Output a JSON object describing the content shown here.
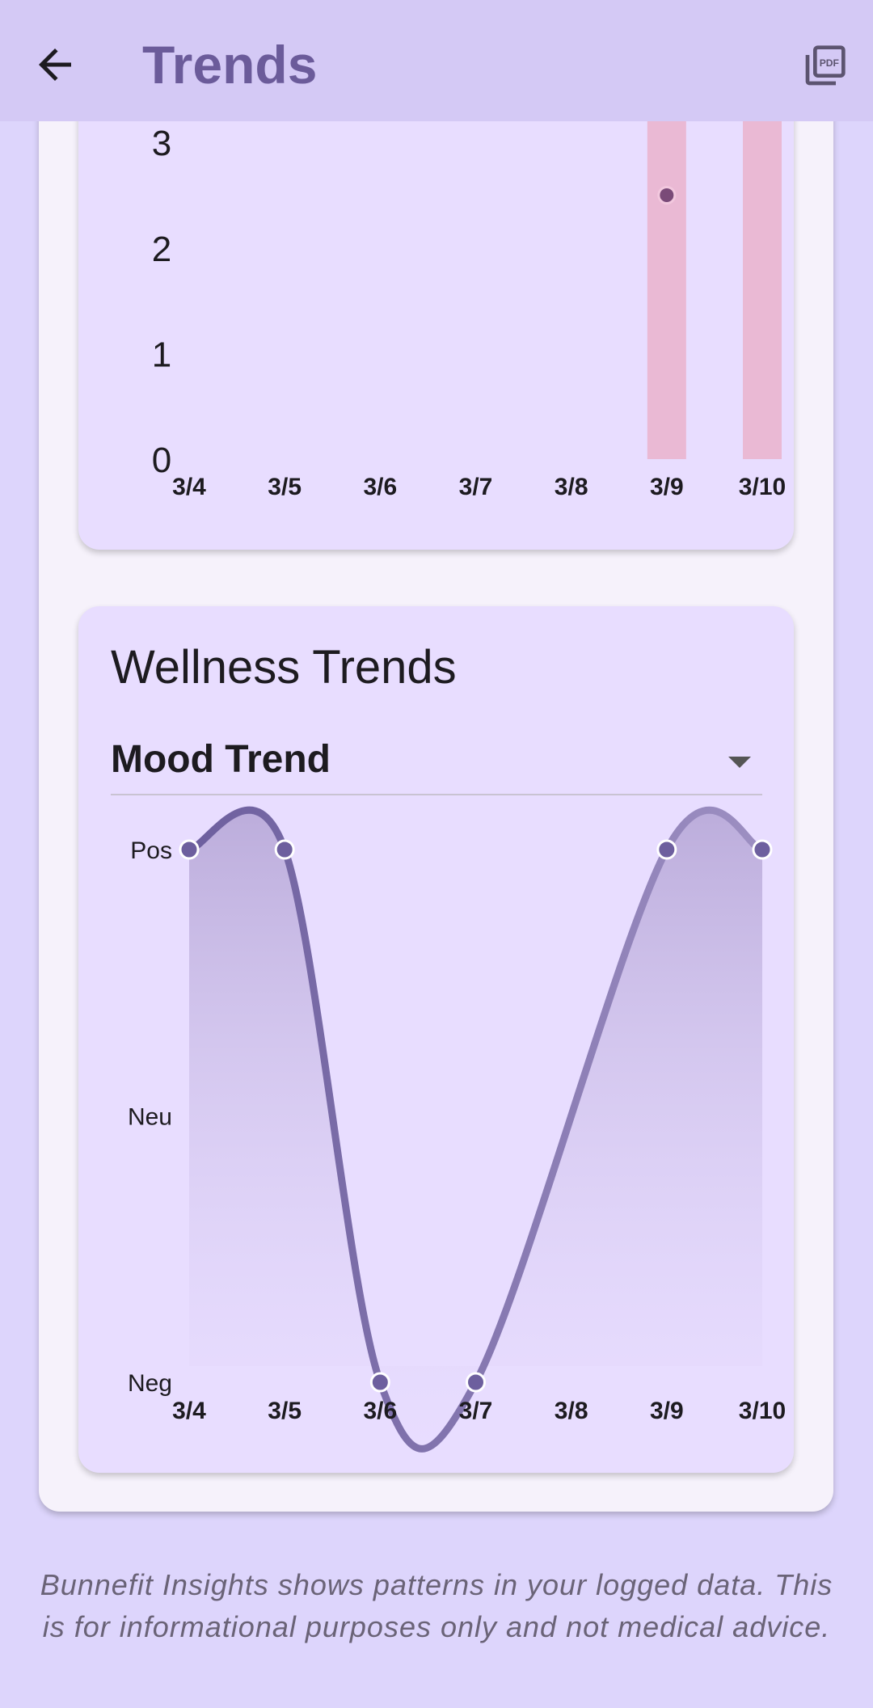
{
  "app_bar": {
    "title": "Trends",
    "back_icon": "arrow-left-icon",
    "pdf_icon": "picture-as-pdf-icon",
    "pdf_icon_text": "PDF"
  },
  "colors": {
    "app_bar": "#d4c9f5",
    "title": "#6b5b9a",
    "card": "#e8ddff",
    "bar": "#eab9d4",
    "dot_top": "#7a4a78",
    "mood_line": "#6d5f9e",
    "mood_line_light": "#9d8fc2"
  },
  "chart_data": [
    {
      "type": "bar",
      "categories": [
        "3/4",
        "3/5",
        "3/6",
        "3/7",
        "3/8",
        "3/9",
        "3/10"
      ],
      "values": [
        0,
        0,
        0,
        0,
        0,
        3.2,
        3.2
      ],
      "points": [
        {
          "x": "3/9",
          "y": 2.5
        }
      ],
      "yticks": [
        0,
        1,
        2,
        3
      ],
      "ylim": [
        0,
        3.2
      ],
      "grid": false
    },
    {
      "type": "line",
      "title": "Wellness Trends",
      "categories": [
        "3/4",
        "3/5",
        "3/6",
        "3/7",
        "3/8",
        "3/9",
        "3/10"
      ],
      "series": [
        {
          "values": [
            1,
            1,
            -1,
            -1,
            null,
            1,
            1
          ]
        }
      ],
      "yticks": [
        {
          "value": 1,
          "label": "Pos"
        },
        {
          "value": 0,
          "label": "Neu"
        },
        {
          "value": -1,
          "label": "Neg"
        }
      ],
      "ylim": [
        -1,
        1
      ],
      "smooth": true,
      "area_fill": true,
      "grid": false
    }
  ],
  "wellness": {
    "dropdown_value": "Mood Trend",
    "dropdown_icon": "arrow-drop-down-icon"
  },
  "footer": {
    "disclaimer": "Bunnefit Insights shows patterns in your logged data. This is for informational purposes only and not medical advice."
  }
}
